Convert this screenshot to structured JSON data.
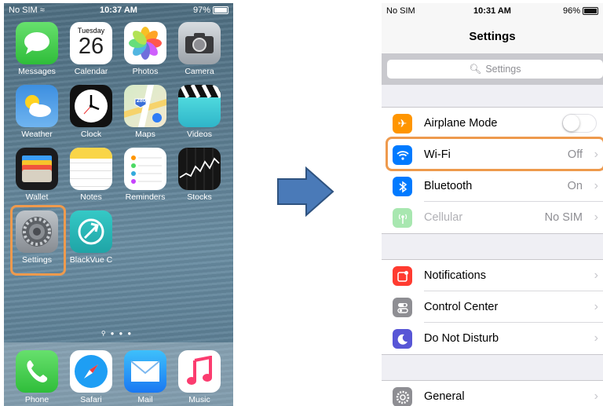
{
  "home": {
    "status": {
      "carrier": "No SIM",
      "time": "10:37 AM",
      "battery": "97%"
    },
    "apps": [
      {
        "id": "messages",
        "label": "Messages"
      },
      {
        "id": "calendar",
        "label": "Calendar",
        "weekday": "Tuesday",
        "day": "26"
      },
      {
        "id": "photos",
        "label": "Photos"
      },
      {
        "id": "camera",
        "label": "Camera"
      },
      {
        "id": "weather",
        "label": "Weather"
      },
      {
        "id": "clock",
        "label": "Clock"
      },
      {
        "id": "maps",
        "label": "Maps",
        "shield": "280"
      },
      {
        "id": "videos",
        "label": "Videos"
      },
      {
        "id": "wallet",
        "label": "Wallet"
      },
      {
        "id": "notes",
        "label": "Notes"
      },
      {
        "id": "reminders",
        "label": "Reminders"
      },
      {
        "id": "stocks",
        "label": "Stocks"
      },
      {
        "id": "settings",
        "label": "Settings"
      },
      {
        "id": "blackvue",
        "label": "BlackVue C"
      }
    ],
    "dock": [
      {
        "id": "phone",
        "label": "Phone"
      },
      {
        "id": "safari",
        "label": "Safari"
      },
      {
        "id": "mail",
        "label": "Mail"
      },
      {
        "id": "music",
        "label": "Music"
      }
    ],
    "highlight_color": "#EE9A4D"
  },
  "settings": {
    "status": {
      "carrier": "No SIM",
      "time": "10:31 AM",
      "battery": "96%"
    },
    "title": "Settings",
    "search_placeholder": "Settings",
    "groups": [
      [
        {
          "label": "Airplane Mode",
          "icon": "airplane-icon",
          "color": "#FF9500",
          "toggle": false
        },
        {
          "label": "Wi-Fi",
          "icon": "wifi-icon",
          "color": "#007AFF",
          "value": "Off"
        },
        {
          "label": "Bluetooth",
          "icon": "bluetooth-icon",
          "color": "#007AFF",
          "value": "On"
        },
        {
          "label": "Cellular",
          "icon": "cellular-icon",
          "color": "#4CD964",
          "value": "No SIM",
          "disabled": true
        }
      ],
      [
        {
          "label": "Notifications",
          "icon": "notifications-icon",
          "color": "#FF3B30"
        },
        {
          "label": "Control Center",
          "icon": "control-center-icon",
          "color": "#8E8E93"
        },
        {
          "label": "Do Not Disturb",
          "icon": "moon-icon",
          "color": "#5856D6"
        }
      ],
      [
        {
          "label": "General",
          "icon": "gear-icon",
          "color": "#8E8E93"
        }
      ]
    ]
  }
}
